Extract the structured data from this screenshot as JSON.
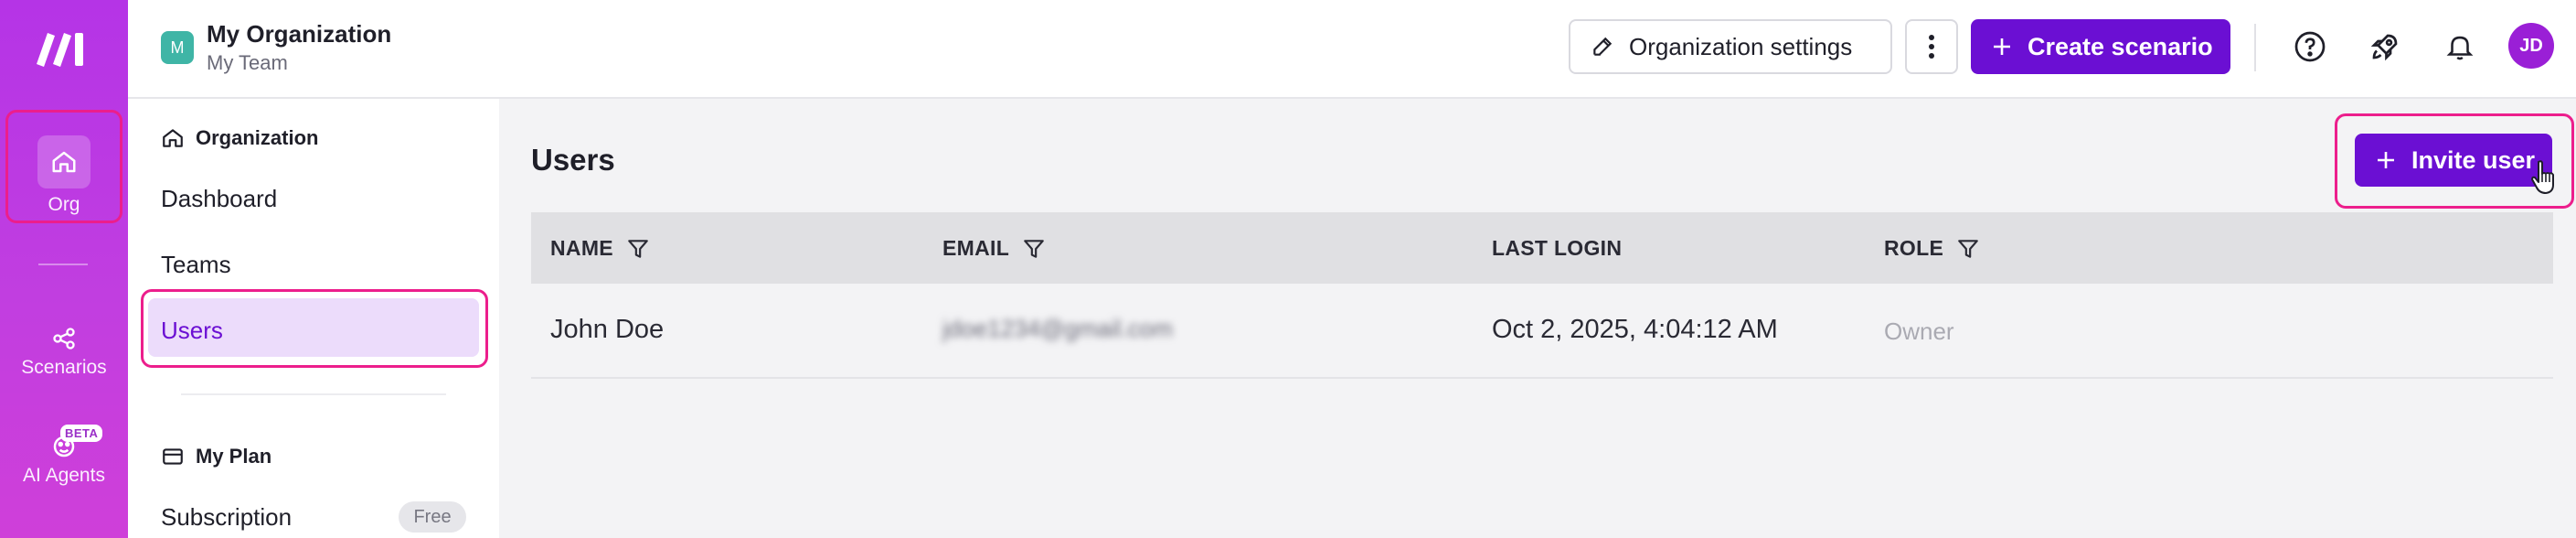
{
  "header": {
    "org_avatar": "M",
    "org_name": "My Organization",
    "team_name": "My Team",
    "settings_label": "Organization settings",
    "create_label": "Create scenario",
    "user_initials": "JD"
  },
  "rail": {
    "items": [
      {
        "label": "Org",
        "icon": "home-icon"
      },
      {
        "label": "Scenarios",
        "icon": "share-icon"
      },
      {
        "label": "AI Agents",
        "icon": "agents-icon",
        "badge": "BETA"
      }
    ]
  },
  "sidebar": {
    "org_heading": "Organization",
    "items": [
      {
        "label": "Dashboard"
      },
      {
        "label": "Teams"
      },
      {
        "label": "Users",
        "active": true
      }
    ],
    "plan_heading": "My Plan",
    "plan_items": [
      {
        "label": "Subscription",
        "badge": "Free"
      }
    ]
  },
  "main": {
    "title": "Users",
    "invite_label": "Invite user",
    "columns": [
      {
        "label": "NAME",
        "filter": true
      },
      {
        "label": "EMAIL",
        "filter": true
      },
      {
        "label": "LAST LOGIN",
        "filter": false
      },
      {
        "label": "ROLE",
        "filter": true
      }
    ],
    "rows": [
      {
        "name": "John Doe",
        "email": "jdoe1234@gmail.com",
        "last_login": "Oct 2, 2025, 4:04:12 AM",
        "role": "Owner"
      }
    ]
  },
  "colors": {
    "accent": "#6b0fd3",
    "rail": "#c13ee0",
    "highlight": "#ec1e8c",
    "active_bg": "#ecdcfb"
  }
}
